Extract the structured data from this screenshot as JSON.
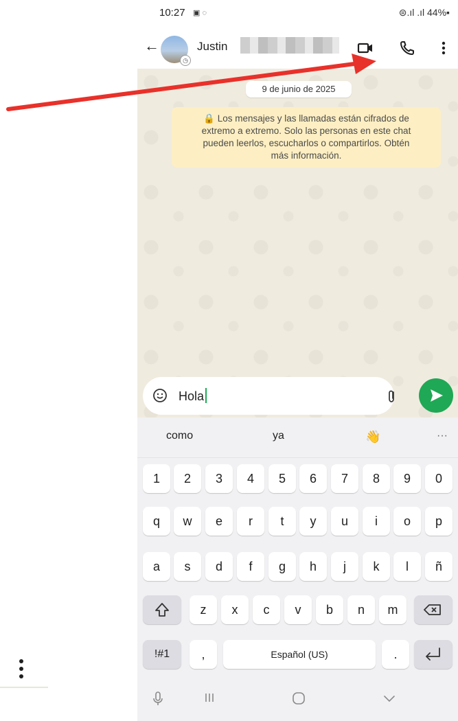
{
  "status": {
    "time": "10:27",
    "left_icons": "▣ ◌",
    "right": "⊜.ıl .ıl 44%▪"
  },
  "header": {
    "contact_name": "Justin"
  },
  "chat": {
    "date": "9 de junio de 2025",
    "notice_lines": [
      "🔒 Los mensajes y las llamadas están cifrados de",
      "extremo a extremo. Solo las personas en este chat",
      "pueden leerlos, escucharlos o compartirlos. Obtén",
      "más información."
    ]
  },
  "composer": {
    "value": "Hola"
  },
  "keyboard": {
    "suggestions": [
      "como",
      "ya",
      "👋",
      "···"
    ],
    "row_numbers": [
      "1",
      "2",
      "3",
      "4",
      "5",
      "6",
      "7",
      "8",
      "9",
      "0"
    ],
    "row_q": [
      "q",
      "w",
      "e",
      "r",
      "t",
      "y",
      "u",
      "i",
      "o",
      "p"
    ],
    "row_a": [
      "a",
      "s",
      "d",
      "f",
      "g",
      "h",
      "j",
      "k",
      "l",
      "ñ"
    ],
    "row_z": [
      "z",
      "x",
      "c",
      "v",
      "b",
      "n",
      "m"
    ],
    "symbols_label": "!#1",
    "comma": ",",
    "space_label": "Español (US)",
    "period": "."
  },
  "colors": {
    "accent": "#1fa855",
    "arrow": "#e8312a",
    "chat_bg": "#f0ebdf",
    "notice_bg": "#fdefc3"
  },
  "icons": [
    "back-arrow-icon",
    "video-call-icon",
    "phone-call-icon",
    "more-vert-icon",
    "sticker-icon",
    "attach-icon",
    "send-icon",
    "shift-icon",
    "backspace-icon",
    "enter-icon",
    "mic-icon",
    "recents-icon",
    "home-icon",
    "hide-keyboard-icon"
  ]
}
